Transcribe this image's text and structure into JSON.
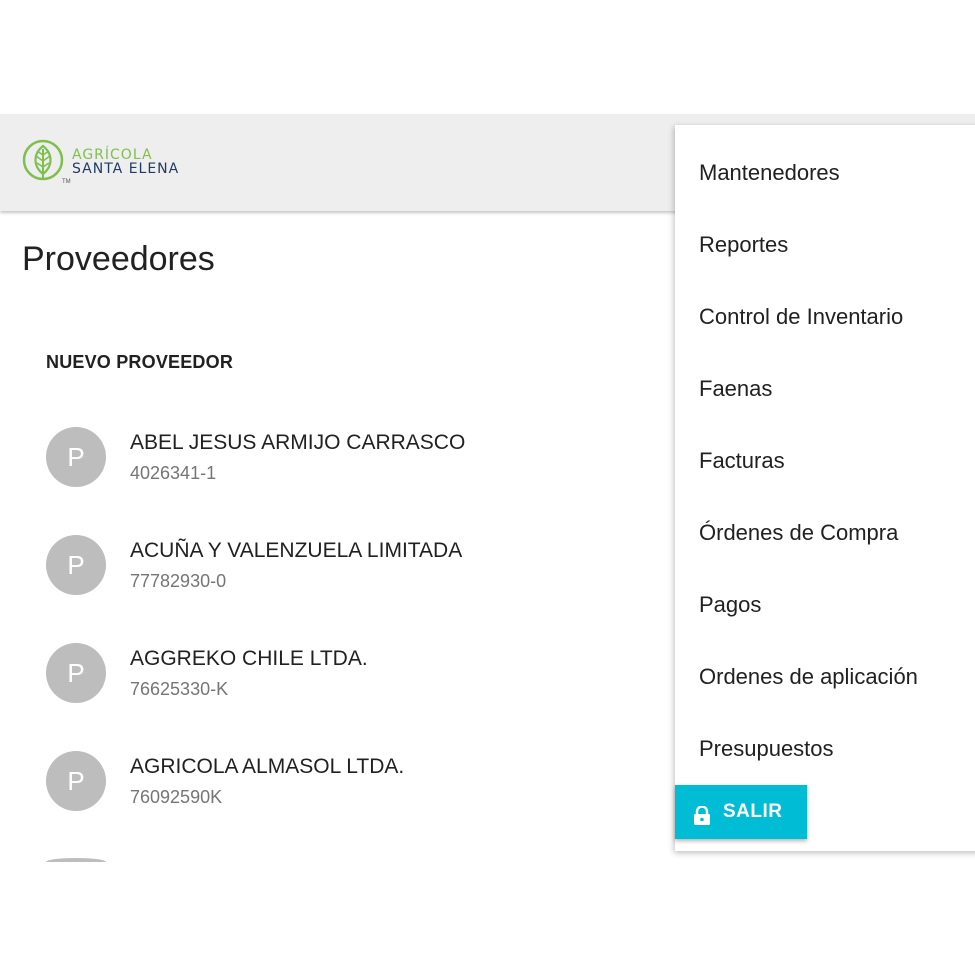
{
  "header": {
    "logo_line1": "AGRÍCOLA",
    "logo_line2": "SANTA ELENA",
    "logo_tm": "TM"
  },
  "page": {
    "title": "Proveedores",
    "new_button_label": "NUEVO PROVEEDOR"
  },
  "suppliers": [
    {
      "avatar": "P",
      "name": "ABEL JESUS ARMIJO CARRASCO",
      "id": "4026341-1"
    },
    {
      "avatar": "P",
      "name": "ACUÑA Y VALENZUELA LIMITADA",
      "id": "77782930-0"
    },
    {
      "avatar": "P",
      "name": "AGGREKO CHILE LTDA.",
      "id": "76625330-K"
    },
    {
      "avatar": "P",
      "name": "AGRICOLA ALMASOL LTDA.",
      "id": "76092590K"
    }
  ],
  "menu": {
    "items": [
      "Mantenedores",
      "Reportes",
      "Control de Inventario",
      "Faenas",
      "Facturas",
      "Órdenes de Compra",
      "Pagos",
      "Ordenes de aplicación",
      "Presupuestos"
    ],
    "logout_label": "SALIR",
    "logout_icon": "lock-icon"
  },
  "colors": {
    "accent": "#00bcd4",
    "appbar": "#eeeeee",
    "avatar": "#bdbdbd",
    "logo_green": "#7fbf4d",
    "logo_navy": "#1f3b63"
  }
}
